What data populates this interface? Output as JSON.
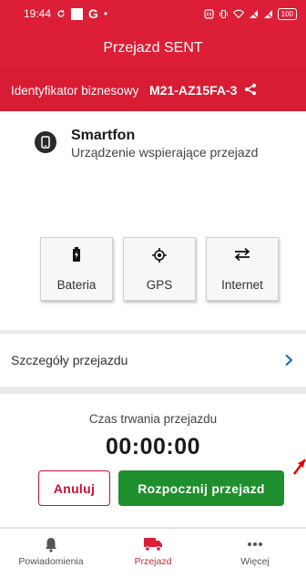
{
  "statusbar": {
    "time": "19:44",
    "g": "G",
    "dot": "•",
    "battery": "100"
  },
  "header": {
    "title": "Przejazd SENT"
  },
  "id_bar": {
    "label": "Identyfikator biznesowy",
    "value": "M21-AZ15FA-3"
  },
  "device": {
    "title": "Smartfon",
    "subtitle": "Urządzenie wspierające przejazd"
  },
  "capabilities": [
    {
      "label": "Bateria",
      "icon": "battery-icon"
    },
    {
      "label": "GPS",
      "icon": "gps-icon"
    },
    {
      "label": "Internet",
      "icon": "transfer-arrows-icon"
    }
  ],
  "details": {
    "label": "Szczegóły przejazdu"
  },
  "trip": {
    "duration_label": "Czas trwania przejazdu",
    "timer": "00:00:00"
  },
  "buttons": {
    "cancel": "Anuluj",
    "start": "Rozpocznij przejazd"
  },
  "nav": {
    "items": [
      {
        "label": "Powiadomienia",
        "icon": "bell-icon"
      },
      {
        "label": "Przejazd",
        "icon": "truck-icon",
        "active": true
      },
      {
        "label": "Więcej",
        "icon": "more-dots-icon"
      }
    ]
  },
  "colors": {
    "brand_red": "#dc1e36",
    "start_green": "#1f8f2e",
    "cancel_red": "#c8102e",
    "link_blue": "#1565c0",
    "annotation_red": "#e00000"
  }
}
